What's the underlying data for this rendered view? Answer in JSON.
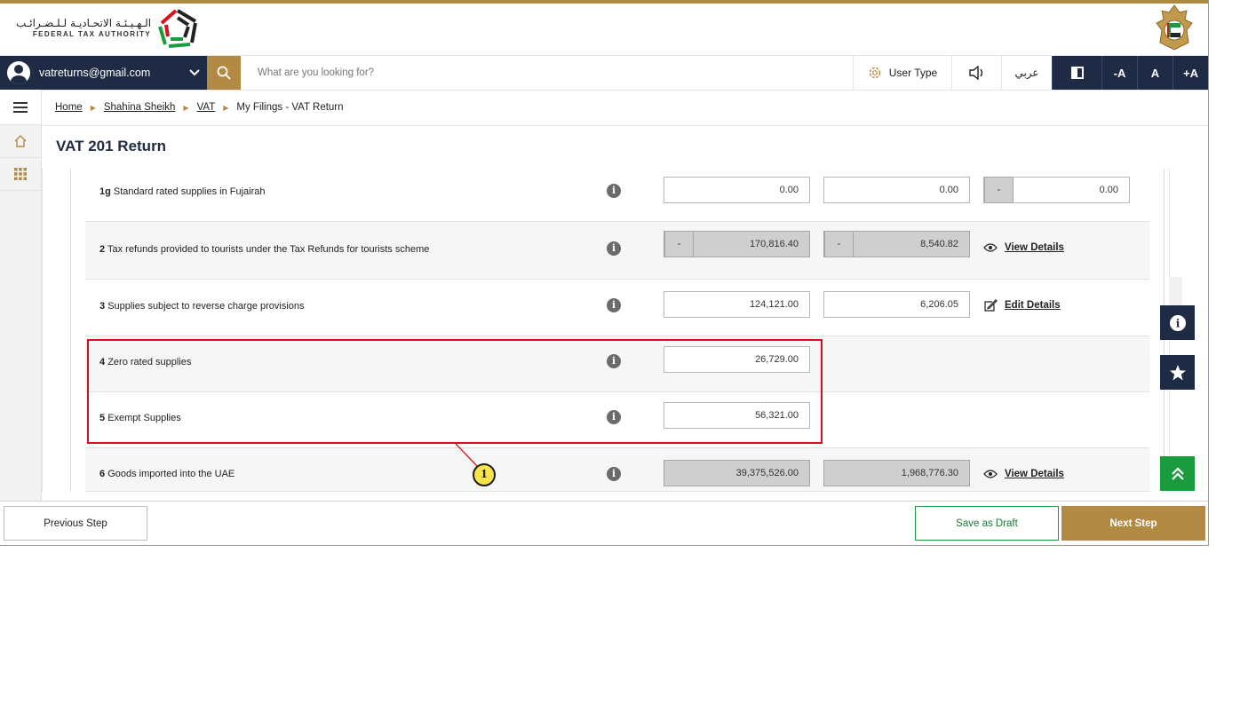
{
  "header": {
    "logo_arabic": "الـهـيـئـة الاتحـاديـة لـلـضـرائـب",
    "logo_english": "FEDERAL TAX AUTHORITY"
  },
  "toolbar": {
    "user_email": "vatreturns@gmail.com",
    "search_placeholder": "What are you looking for?",
    "user_type_label": "User Type",
    "language_label": "عربي",
    "font_decrease": "-A",
    "font_normal": "A",
    "font_increase": "+A"
  },
  "breadcrumb": {
    "home": "Home",
    "user": "Shahina Sheikh",
    "vat": "VAT",
    "current": "My Filings - VAT Return"
  },
  "page": {
    "title": "VAT 201 Return"
  },
  "rows": [
    {
      "num": "1g",
      "label": "Standard rated supplies in Fujairah",
      "amount": "0.00",
      "vat": "0.00",
      "adjust_prefix": "-",
      "adjustment": "0.00"
    },
    {
      "num": "2",
      "label": "Tax refunds provided to tourists under the Tax Refunds for tourists scheme",
      "amount_prefix": "-",
      "amount": "170,816.40",
      "vat_prefix": "-",
      "vat": "8,540.82",
      "action": "View Details"
    },
    {
      "num": "3",
      "label": "Supplies subject to reverse charge provisions",
      "amount": "124,121.00",
      "vat": "6,206.05",
      "action": "Edit Details"
    },
    {
      "num": "4",
      "label": "Zero rated supplies",
      "amount": "26,729.00"
    },
    {
      "num": "5",
      "label": "Exempt Supplies",
      "amount": "56,321.00"
    },
    {
      "num": "6",
      "label": "Goods imported into the UAE",
      "amount": "39,375,526.00",
      "vat": "1,968,776.30",
      "action": "View Details"
    }
  ],
  "annotation": {
    "callout_number": "1"
  },
  "footer": {
    "previous": "Previous Step",
    "save_draft": "Save as Draft",
    "next": "Next Step"
  },
  "colors": {
    "navy": "#1f2a44",
    "gold": "#b38a44",
    "green": "#1a9c3e",
    "highlight": "#d6111b"
  }
}
